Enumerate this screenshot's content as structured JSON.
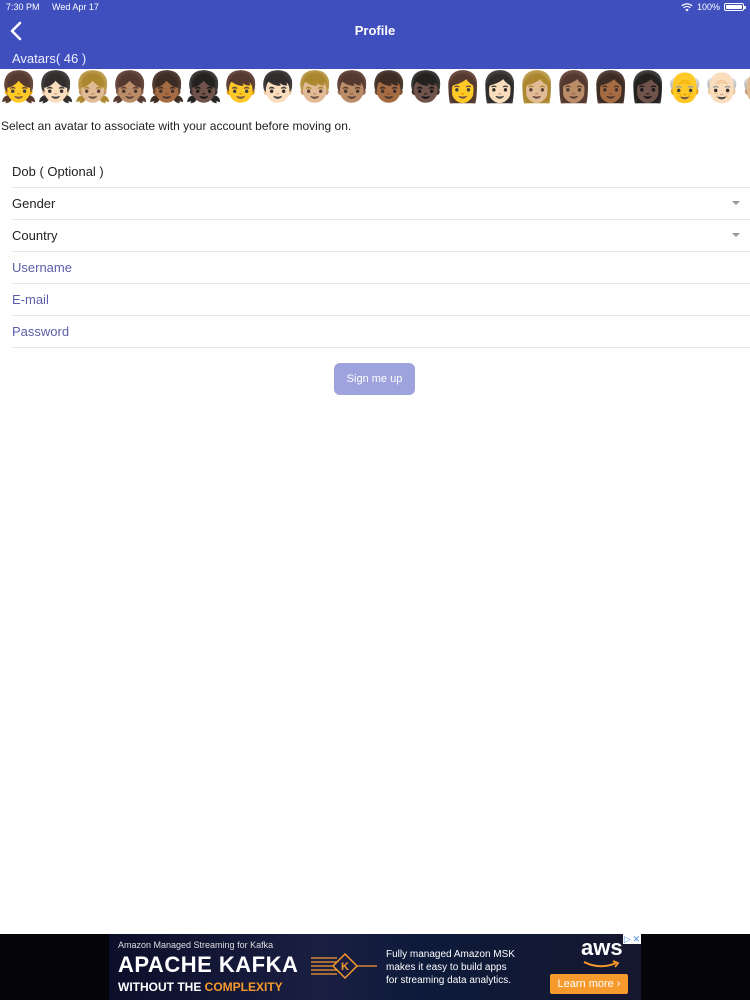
{
  "status_bar": {
    "time": "7:30 PM",
    "date": "Wed Apr 17",
    "battery": "100%"
  },
  "nav": {
    "title": "Profile",
    "back_icon": "chevron-left-icon"
  },
  "avatars": {
    "label": "Avatars( 46 )",
    "items": [
      "👧",
      "👧🏻",
      "👧🏼",
      "👧🏽",
      "👧🏾",
      "👧🏿",
      "👦",
      "👦🏻",
      "👦🏼",
      "👦🏽",
      "👦🏾",
      "👦🏿",
      "👩",
      "👩🏻",
      "👩🏼",
      "👩🏽",
      "👩🏾",
      "👩🏿",
      "👴",
      "👴🏻",
      "👴🏼"
    ]
  },
  "hint": "Select an avatar to associate with your account before moving on.",
  "form": {
    "dob": "Dob ( Optional )",
    "gender": "Gender",
    "country": "Country",
    "username_placeholder": "Username",
    "email_placeholder": "E-mail",
    "password_placeholder": "Password",
    "signup_label": "Sign me up"
  },
  "ad": {
    "kicker": "Amazon Managed Streaming for Kafka",
    "headline": "APACHE KAFKA",
    "sub_prefix": "WITHOUT THE ",
    "sub_accent": "COMPLEXITY",
    "copy_lines": [
      "Fully managed Amazon MSK",
      "makes it easy to build apps",
      "for streaming data analytics."
    ],
    "brand": "aws",
    "cta": "Learn more ›"
  },
  "colors": {
    "header": "#3F4FBE",
    "button": "#9EA3DD",
    "placeholder": "#5B5FA8",
    "ad_accent": "#F79A2E"
  }
}
